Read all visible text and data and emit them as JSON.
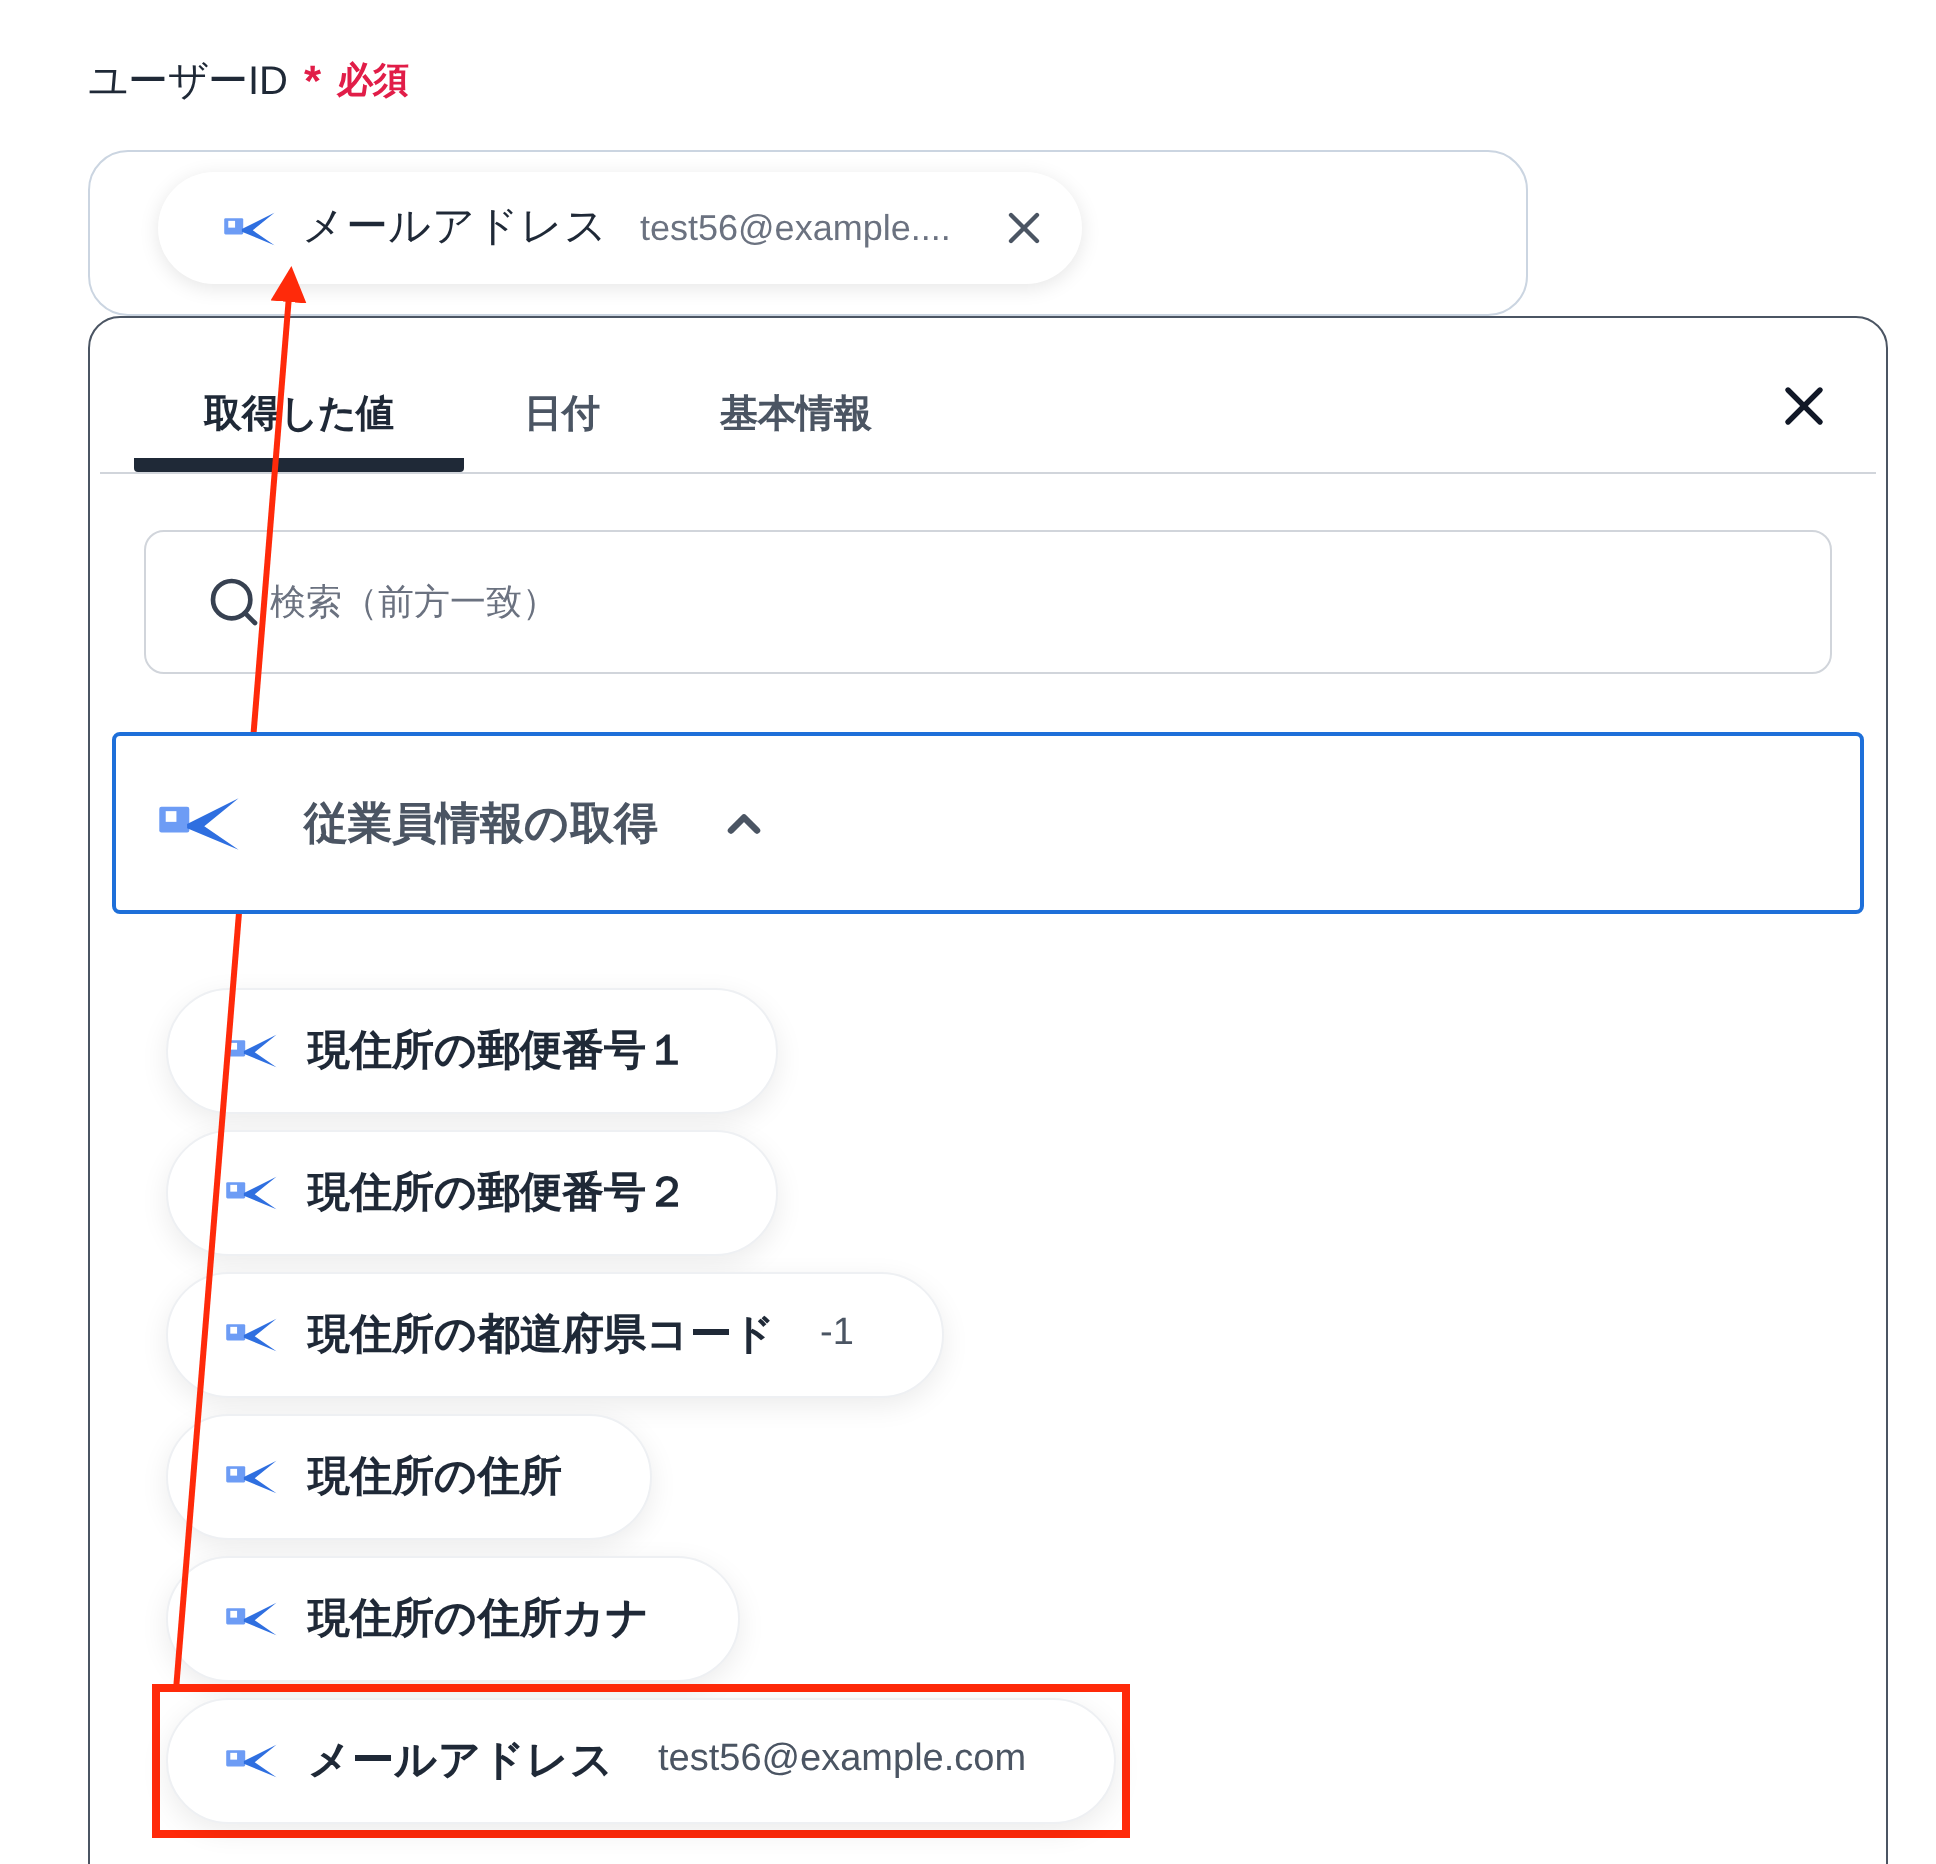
{
  "field": {
    "label": "ユーザーID",
    "required_mark": "*",
    "required_text": "必須",
    "chip": {
      "name": "メールアドレス",
      "value": "test56@example...."
    }
  },
  "panel": {
    "tabs": [
      {
        "label": "取得した値",
        "selected": true
      },
      {
        "label": "日付",
        "selected": false
      },
      {
        "label": "基本情報",
        "selected": false
      }
    ],
    "search": {
      "placeholder": "検索（前方一致）"
    },
    "section": {
      "title": "従業員情報の取得",
      "expanded": true
    },
    "items": [
      {
        "name": "現住所の郵便番号１",
        "highlighted": false
      },
      {
        "name": "現住所の郵便番号２",
        "highlighted": false
      },
      {
        "name": "現住所の都道府県コード",
        "value": "-1",
        "highlighted": false
      },
      {
        "name": "現住所の住所",
        "highlighted": false
      },
      {
        "name": "現住所の住所カナ",
        "highlighted": false
      },
      {
        "name": "メールアドレス",
        "value": "test56@example.com",
        "highlighted": true
      }
    ]
  }
}
